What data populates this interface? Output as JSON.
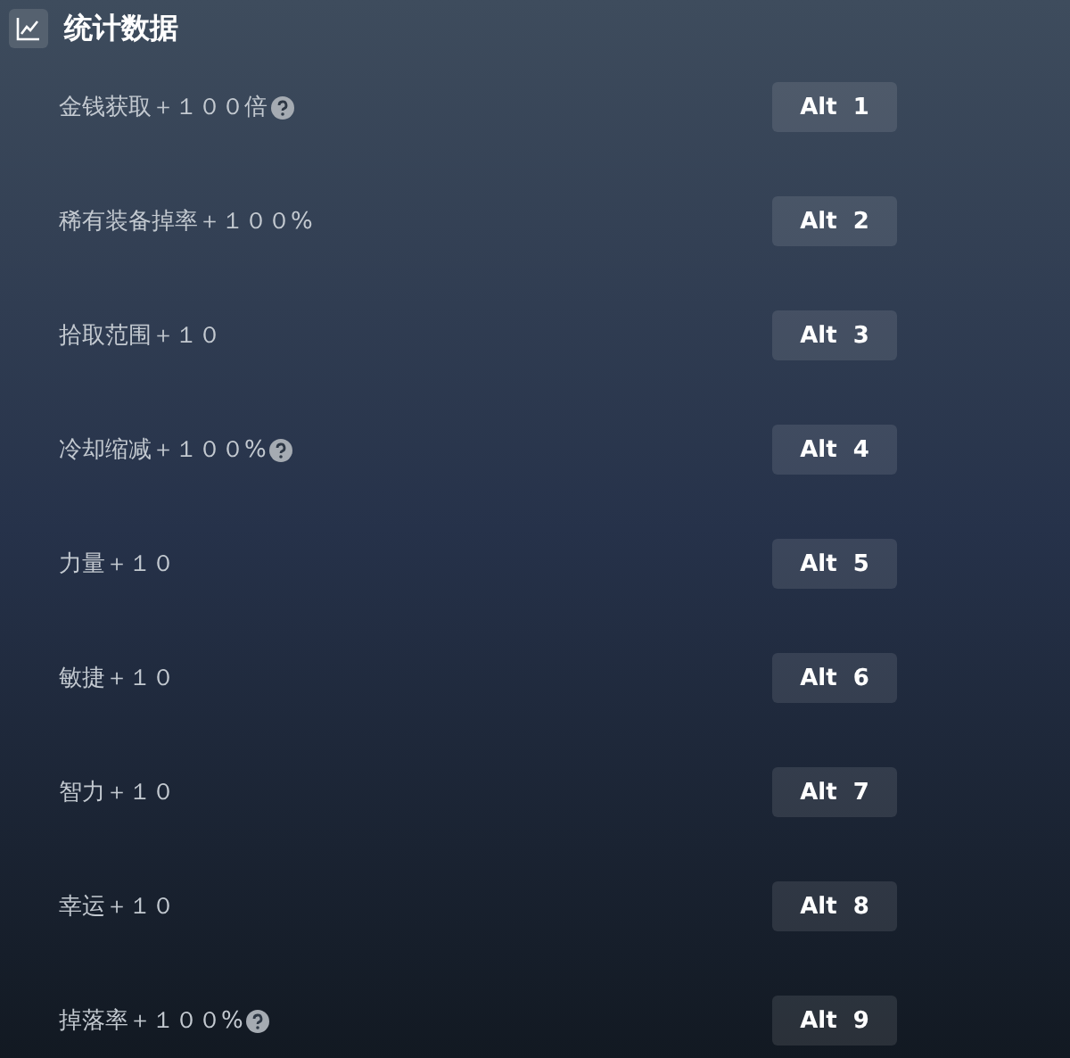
{
  "title": "统计数据",
  "cheats": [
    {
      "label": "金钱获取＋１００倍",
      "help": true,
      "hotkey": "Alt  1"
    },
    {
      "label": "稀有装备掉率＋１００%",
      "help": false,
      "hotkey": "Alt  2"
    },
    {
      "label": "拾取范围＋１０",
      "help": false,
      "hotkey": "Alt  3"
    },
    {
      "label": "冷却缩减＋１００%",
      "help": true,
      "hotkey": "Alt  4"
    },
    {
      "label": "力量＋１０",
      "help": false,
      "hotkey": "Alt  5"
    },
    {
      "label": "敏捷＋１０",
      "help": false,
      "hotkey": "Alt  6"
    },
    {
      "label": "智力＋１０",
      "help": false,
      "hotkey": "Alt  7"
    },
    {
      "label": "幸运＋１０",
      "help": false,
      "hotkey": "Alt  8"
    },
    {
      "label": "掉落率＋１００%",
      "help": true,
      "hotkey": "Alt  9"
    }
  ]
}
